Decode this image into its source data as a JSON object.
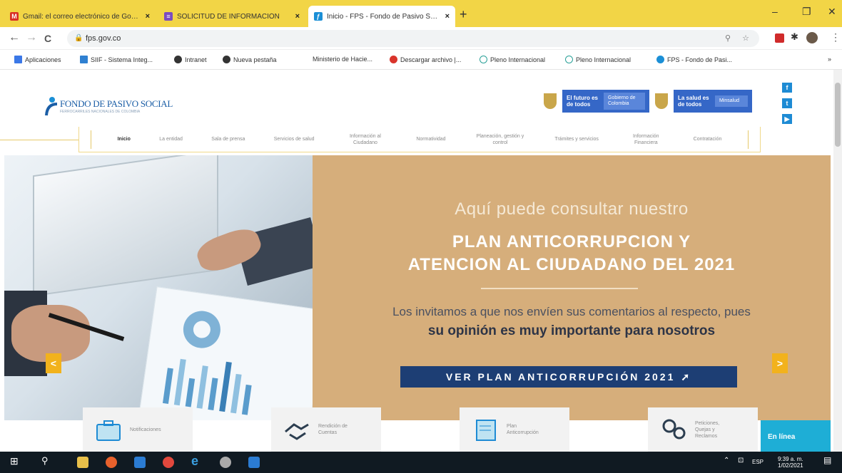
{
  "browser": {
    "tabs": [
      {
        "title": "Gmail: el correo electrónico de Google",
        "favicon": "gmail-icon",
        "active": false
      },
      {
        "title": "SOLICITUD DE INFORMACIÓN",
        "favicon": "forms-icon",
        "active": false
      },
      {
        "title": "Inicio - FPS - Fondo de Pasivo Social",
        "favicon": "fps-icon",
        "active": true
      }
    ],
    "new_tab": "+",
    "close": "×",
    "window_controls": {
      "minimize": "–",
      "maximize": "❐",
      "close": "✕"
    },
    "nav": {
      "back": "←",
      "forward": "→",
      "reload": "C"
    },
    "url": "fps.gov.co",
    "bookmarks": [
      {
        "label": "Aplicaciones",
        "color": "#3b78e7"
      },
      {
        "label": "SIIF - Sistema Integ...",
        "color": "#2f80d1"
      },
      {
        "label": "Intranet",
        "color": "#333333"
      },
      {
        "label": "Nueva pestaña",
        "color": "#333333"
      },
      {
        "label": "Ministerio de Hacie...",
        "color": "#ffffff"
      },
      {
        "label": "Descargar archivo |...",
        "color": "#d9342b"
      },
      {
        "label": "Pleno Internacional",
        "color": "#2aa198"
      },
      {
        "label": "Pleno Internacional",
        "color": "#2aa198"
      },
      {
        "label": "FPS - Fondo de Pasi...",
        "color": "#1b5ea6"
      }
    ],
    "bookmarks_more": "»"
  },
  "site": {
    "logo_text": "FONDO DE PASIVO SOCIAL",
    "logo_sub": "FERROCARRILES NACIONALES DE COLOMBIA",
    "banner1_a": "El futuro es de todos",
    "banner1_b": "Gobierno de Colombia",
    "banner2_a": "La salud es de todos",
    "banner2_b": "Minsalud",
    "social": [
      "f",
      "t",
      "▶"
    ],
    "menu": [
      "Inicio",
      "La entidad",
      "Sala de prensa",
      "Servicios de salud",
      "Información al Ciudadano",
      "Normatividad",
      "Planeación, gestión y control",
      "Trámites y servicios",
      "Información Financiera",
      "Contratación"
    ],
    "hero": {
      "subtitle": "Aquí puede consultar nuestro",
      "title_line1": "PLAN ANTICORRUPCION Y",
      "title_line2": "ATENCION AL CIUDADANO DEL 2021",
      "para1": "Los invitamos a que nos envíen sus comentarios al respecto, pues",
      "para2": "su opinión es muy importante para nosotros",
      "cta": "VER PLAN ANTICORRUPCIÓN 2021",
      "prev": "<",
      "next": ">"
    },
    "cards": [
      {
        "label": "Notificaciones",
        "icon": "briefcase-icon"
      },
      {
        "label": "Rendición de Cuentas",
        "icon": "handshake-icon"
      },
      {
        "label": "Plan Anticorrupción",
        "icon": "plan-icon"
      },
      {
        "label": "Peticiones, Quejas y Reclamos",
        "icon": "gears-icon"
      }
    ],
    "en_linea": "En línea"
  },
  "taskbar": {
    "tray_lang": "ESP",
    "time": "9:39 a. m.",
    "date": "1/02/2021"
  }
}
